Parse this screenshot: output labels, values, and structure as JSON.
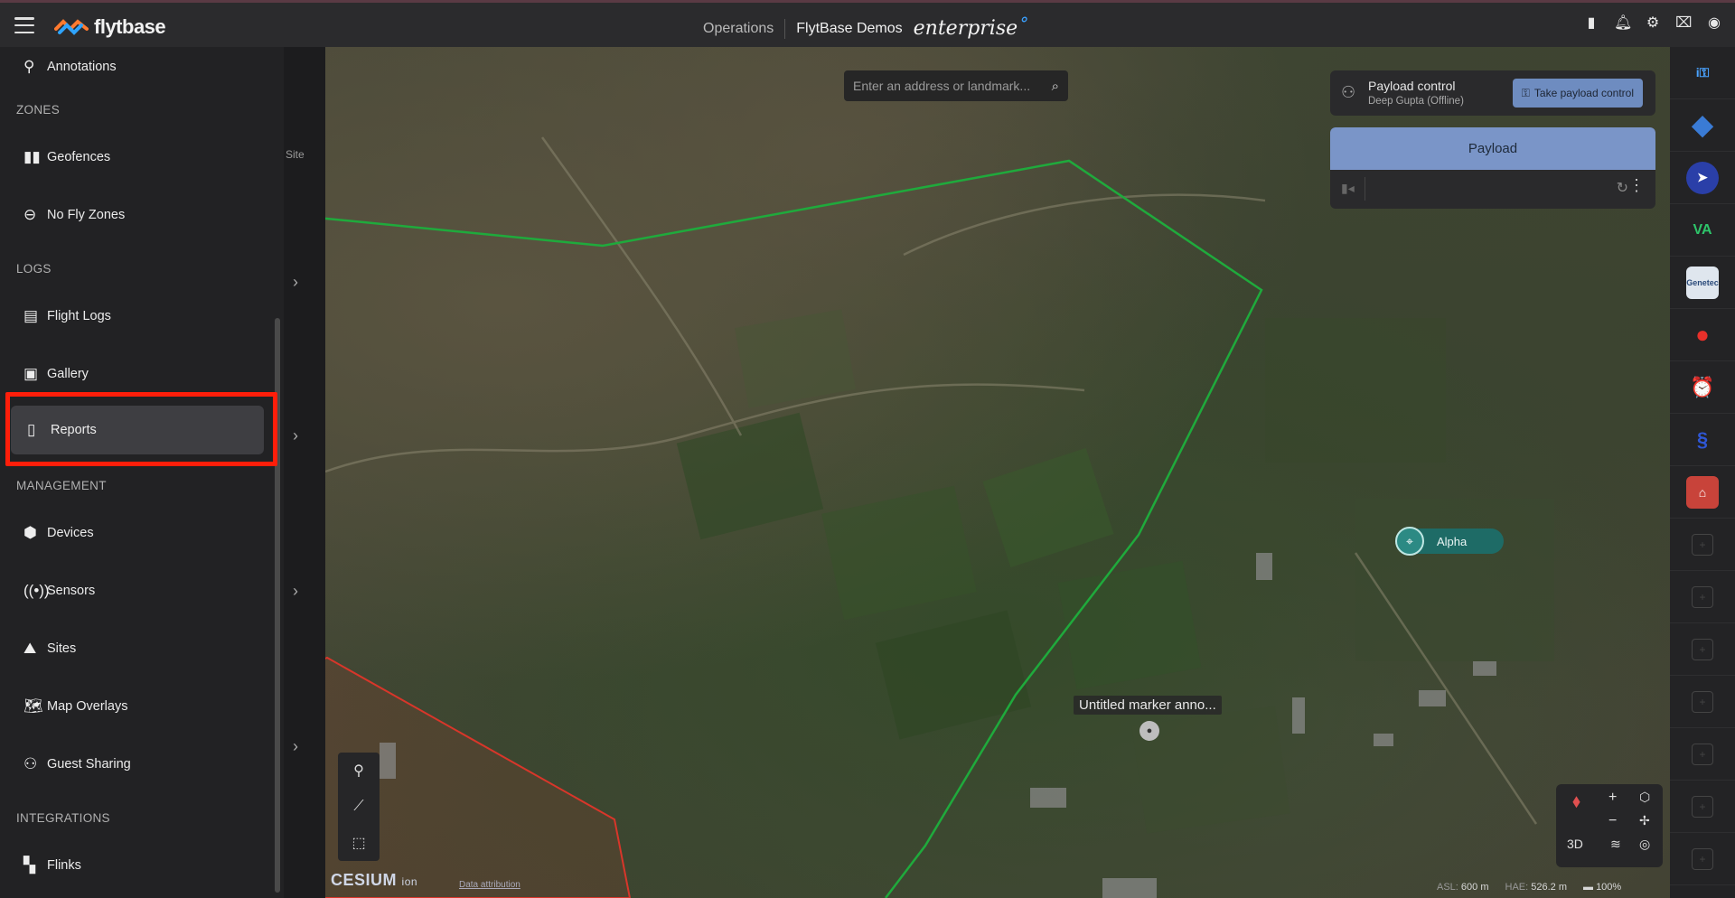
{
  "topbar": {
    "brand": "flytbase",
    "section": "Operations",
    "org": "FlytBase Demos",
    "edition": "enterprise",
    "icons": [
      "bar-chart-icon",
      "bell-icon",
      "gear-icon",
      "gift-icon",
      "user-circle-icon"
    ]
  },
  "sidebar": {
    "items_top": [
      {
        "label": "Annotations"
      }
    ],
    "zones_label": "ZONES",
    "zones": [
      {
        "label": "Geofences"
      },
      {
        "label": "No Fly Zones"
      }
    ],
    "logs_label": "LOGS",
    "logs": [
      {
        "label": "Flight Logs"
      },
      {
        "label": "Gallery"
      },
      {
        "label": "Reports"
      }
    ],
    "management_label": "MANAGEMENT",
    "management": [
      {
        "label": "Devices"
      },
      {
        "label": "Sensors"
      },
      {
        "label": "Sites"
      },
      {
        "label": "Map Overlays"
      },
      {
        "label": "Guest Sharing"
      }
    ],
    "integrations_label": "INTEGRATIONS",
    "integrations": [
      {
        "label": "Flinks"
      }
    ]
  },
  "peek": {
    "site_label": "Site"
  },
  "map": {
    "search_placeholder": "Enter an address or landmark...",
    "payload_control": {
      "title": "Payload control",
      "subtitle": "Deep Gupta (Offline)",
      "button": "Take payload control"
    },
    "payload_panel": {
      "title": "Payload"
    },
    "drone_label": "Alpha",
    "marker_label": "Untitled marker anno...",
    "nav": {
      "mode": "3D"
    },
    "attribution": {
      "cesium": "CESIUM",
      "ion": "ion",
      "data": "Data attribution"
    },
    "status": {
      "asl_label": "ASL:",
      "asl": "600 m",
      "hae_label": "HAE:",
      "hae": "526.2 m",
      "battery": "100%"
    },
    "colors": {
      "geofence_green": "#1faa3c",
      "nofly_red": "#d8362a",
      "accent_blue": "#7a95c8"
    }
  },
  "rightrail": {
    "apps": [
      "info-app-icon",
      "diamond-app-icon",
      "send-app-icon",
      "va-app-icon",
      "genetec-app-icon",
      "fire-app-icon",
      "alarm-app-icon",
      "dna-app-icon",
      "building-app-icon"
    ],
    "genetec_text": "Genetec",
    "empty_slots": 7
  }
}
